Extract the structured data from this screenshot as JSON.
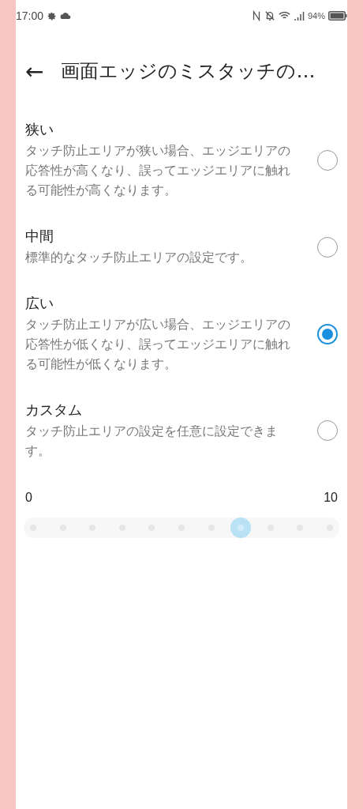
{
  "status_bar": {
    "time": "17:00",
    "battery": "94%"
  },
  "header": {
    "back": "←",
    "title": "画面エッジのミスタッチの…"
  },
  "options": [
    {
      "title": "狭い",
      "description": "タッチ防止エリアが狭い場合、エッジエリアの応答性が高くなり、誤ってエッジエリアに触れる可能性が高くなります。",
      "selected": false
    },
    {
      "title": "中間",
      "description": "標準的なタッチ防止エリアの設定です。",
      "selected": false
    },
    {
      "title": "広い",
      "description": "タッチ防止エリアが広い場合、エッジエリアの応答性が低くなり、誤ってエッジエリアに触れる可能性が低くなります。",
      "selected": true
    },
    {
      "title": "カスタム",
      "description": "タッチ防止エリアの設定を任意に設定できます。",
      "selected": false
    }
  ],
  "slider": {
    "min_label": "0",
    "max_label": "10",
    "level": 0.7,
    "disabled": true
  }
}
